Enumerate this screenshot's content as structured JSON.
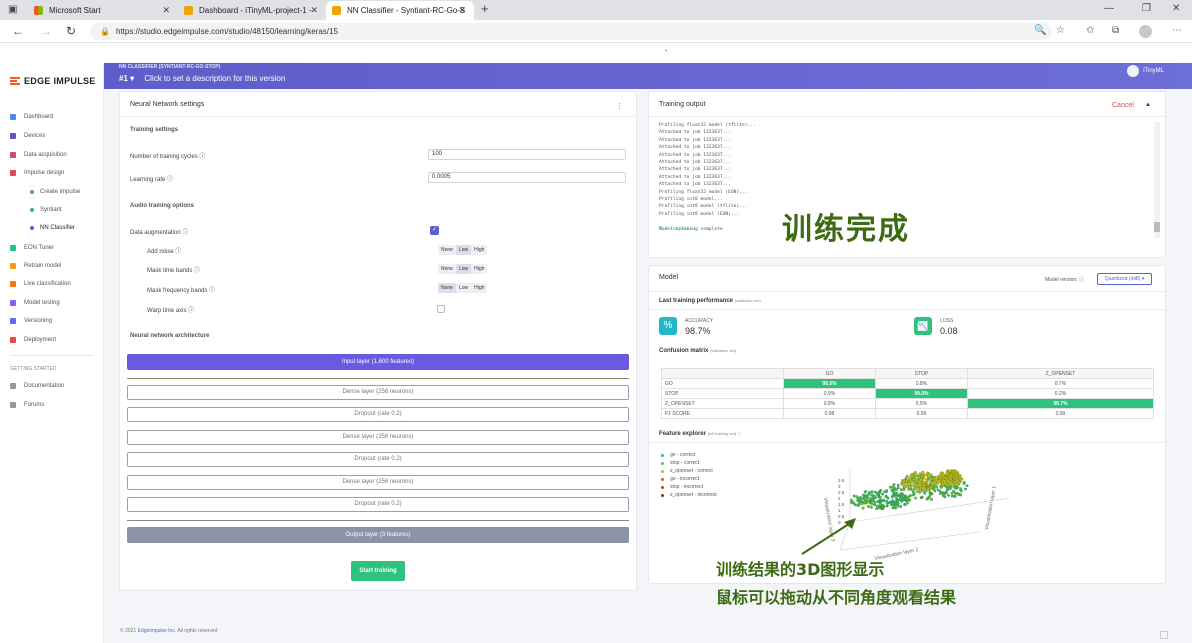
{
  "browser": {
    "tabs": [
      {
        "label": "Microsoft Start",
        "active": false
      },
      {
        "label": "Dashboard - iTinyML-project-1 -",
        "active": false
      },
      {
        "label": "NN Classifier - Syntiant-RC-Go-S",
        "active": true
      }
    ],
    "new_tab": "+",
    "url": "https://studio.edgeimpulse.com/studio/48150/learning/keras/15"
  },
  "sidebar": {
    "logo": "EDGE IMPULSE",
    "items": [
      {
        "label": "Dashboard",
        "color": "#4a90d9"
      },
      {
        "label": "Devices",
        "color": "#5b57d1"
      },
      {
        "label": "Data acquisition",
        "color": "#d04a7a"
      },
      {
        "label": "Impulse design",
        "color": "#e5484d"
      },
      {
        "label": "Create impulse",
        "sub": true
      },
      {
        "label": "Syntiant",
        "sub": true
      },
      {
        "label": "NN Classifier",
        "sub": true,
        "active": true
      },
      {
        "label": "EON Tuner",
        "color": "#2ec27e"
      },
      {
        "label": "Retrain model",
        "color": "#f59e0b"
      },
      {
        "label": "Live classification",
        "color": "#f97316"
      },
      {
        "label": "Model testing",
        "color": "#8b5cf6"
      },
      {
        "label": "Versioning",
        "color": "#6366f1"
      },
      {
        "label": "Deployment",
        "color": "#ef4444"
      }
    ],
    "getting_started": "GETTING STARTED",
    "extra": [
      {
        "label": "Documentation"
      },
      {
        "label": "Forums"
      }
    ]
  },
  "header": {
    "project": "NN CLASSIFIER (SYNTIANT-RC-GO-STOP)",
    "version": "#1 ▾",
    "description": "Click to set a description for this version",
    "user": "iTinyML"
  },
  "settings": {
    "title": "Neural Network settings",
    "training_settings": "Training settings",
    "cycles_label": "Number of training cycles ⓘ",
    "cycles_value": "100",
    "lr_label": "Learning rate ⓘ",
    "lr_value": "0.0005",
    "audio_title": "Audio training options",
    "augmentation_label": "Data augmentation ⓘ",
    "add_noise": "Add noise ⓘ",
    "mask_time": "Mask time bands ⓘ",
    "mask_freq": "Mask frequency bands ⓘ",
    "warp_time": "Warp time axis ⓘ",
    "options": [
      "None",
      "Low",
      "High"
    ],
    "arch_title": "Neural network architecture",
    "input_layer": "Input layer (1,600 features)",
    "layers": [
      "Dense layer (256 neurons)",
      "Dropout (rate 0.2)",
      "Dense layer (256 neurons)",
      "Dropout (rate 0.2)",
      "Dense layer (256 neurons)",
      "Dropout (rate 0.2)"
    ],
    "output_layer": "Output layer (3 features)",
    "start_button": "Start training"
  },
  "training_output": {
    "title": "Training output",
    "cancel": "Cancel",
    "lines": [
      "Profiling float32 model (tflite)...",
      "Attached to job 1323637...",
      "Attached to job 1323637...",
      "Attached to job 1323637...",
      "Attached to job 1323637...",
      "Attached to job 1323637...",
      "Attached to job 1323637...",
      "Attached to job 1323637...",
      "Attached to job 1323637...",
      "Profiling float32 model (EON)...",
      "Profiling int8 model...",
      "Profiling int8 model (tflite)...",
      "Profiling int8 model (EON)...",
      "",
      "Model training complete"
    ],
    "done": "Job completed"
  },
  "model": {
    "title": "Model",
    "version_label": "Model version: ⓘ",
    "version_value": "Quantized (int8) ▾",
    "last_perf": "Last training performance",
    "last_perf_sub": "(validation set)",
    "accuracy_label": "ACCURACY",
    "accuracy_value": "98.7%",
    "loss_label": "LOSS",
    "loss_value": "0.08",
    "cm_title": "Confusion matrix",
    "cm_sub": "(validation set)",
    "cm_cols": [
      "GO",
      "STOP",
      "Z_OPENSET"
    ],
    "cm_rows": [
      {
        "label": "GO",
        "cells": [
          "98.5%",
          "0.8%",
          "0.7%"
        ],
        "hl": 0
      },
      {
        "label": "STOP",
        "cells": [
          "0.9%",
          "99.0%",
          "0.2%"
        ],
        "hl": 1
      },
      {
        "label": "Z_OPENSET",
        "cells": [
          "0.8%",
          "0.5%",
          "98.7%"
        ],
        "hl": 2
      },
      {
        "label": "F1 SCORE",
        "cells": [
          "0.98",
          "0.99",
          "0.99"
        ],
        "hl": -1
      }
    ],
    "fe_title": "Feature explorer",
    "fe_sub": "(full training set) ⓘ",
    "legend": [
      {
        "label": "go - correct",
        "color": "#2ec27e"
      },
      {
        "label": "stop - correct",
        "color": "#6abf2e"
      },
      {
        "label": "z_openset - correct",
        "color": "#b7c52c"
      },
      {
        "label": "go - incorrect",
        "color": "#e5484d"
      },
      {
        "label": "stop - incorrect",
        "color": "#c0392b"
      },
      {
        "label": "z_openset - incorrect",
        "color": "#8e2b22"
      }
    ],
    "axis_labels": [
      "Visualization layer 1",
      "Visualization layer 2",
      "Visualization layer 3"
    ],
    "ticks": [
      "3.5",
      "3",
      "2.5",
      "2",
      "1.5",
      "1",
      "0.5",
      "0"
    ]
  },
  "annotations": {
    "done": "训练完成",
    "line1": "训练结果的3D图形显示",
    "line2": "鼠标可以拖动从不同角度观看结果"
  },
  "footer": {
    "copyright": "© 2021 ",
    "brand": "EdgeImpulse Inc.",
    "rest": " All rights reserved"
  }
}
